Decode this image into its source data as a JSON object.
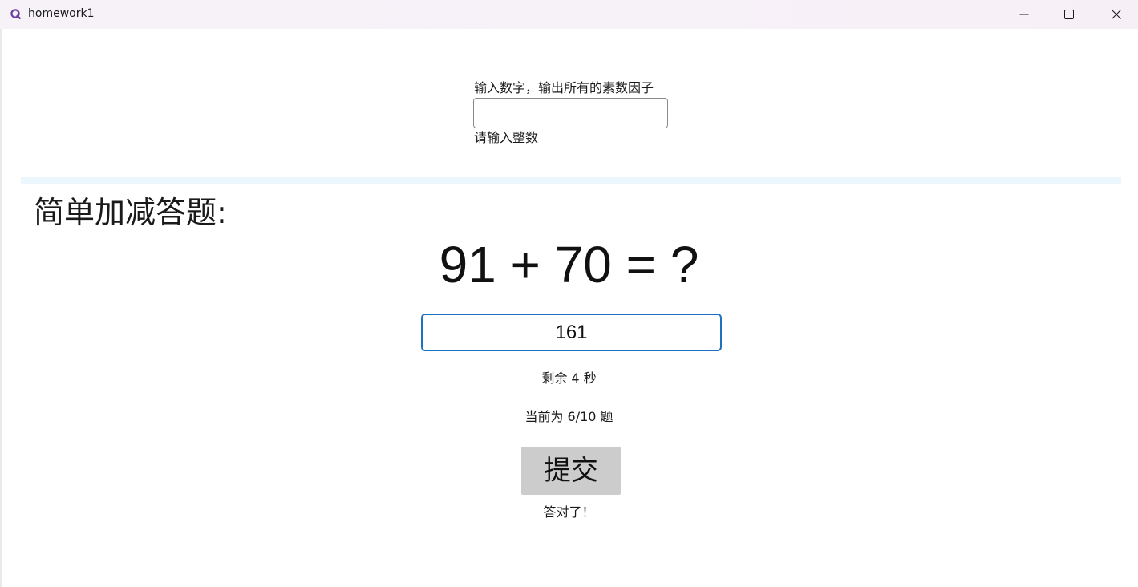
{
  "window": {
    "title": "homework1",
    "icon": "app-logo-icon",
    "controls": [
      "minimize-icon",
      "maximize-icon",
      "close-icon"
    ]
  },
  "prime": {
    "label": "输入数字，输出所有的素数因子",
    "input_value": "",
    "hint": "请输入整数"
  },
  "quiz": {
    "title": "简单加减答题:",
    "equation": "91 + 70 = ?",
    "answer_value": "161",
    "timer": "剩余 4 秒",
    "progress": "当前为 6/10 题",
    "submit_label": "提交",
    "result": "答对了！"
  },
  "colors": {
    "accent": "#1c72c0",
    "divider": "#ebf6fd",
    "button_bg": "#cccccc"
  }
}
